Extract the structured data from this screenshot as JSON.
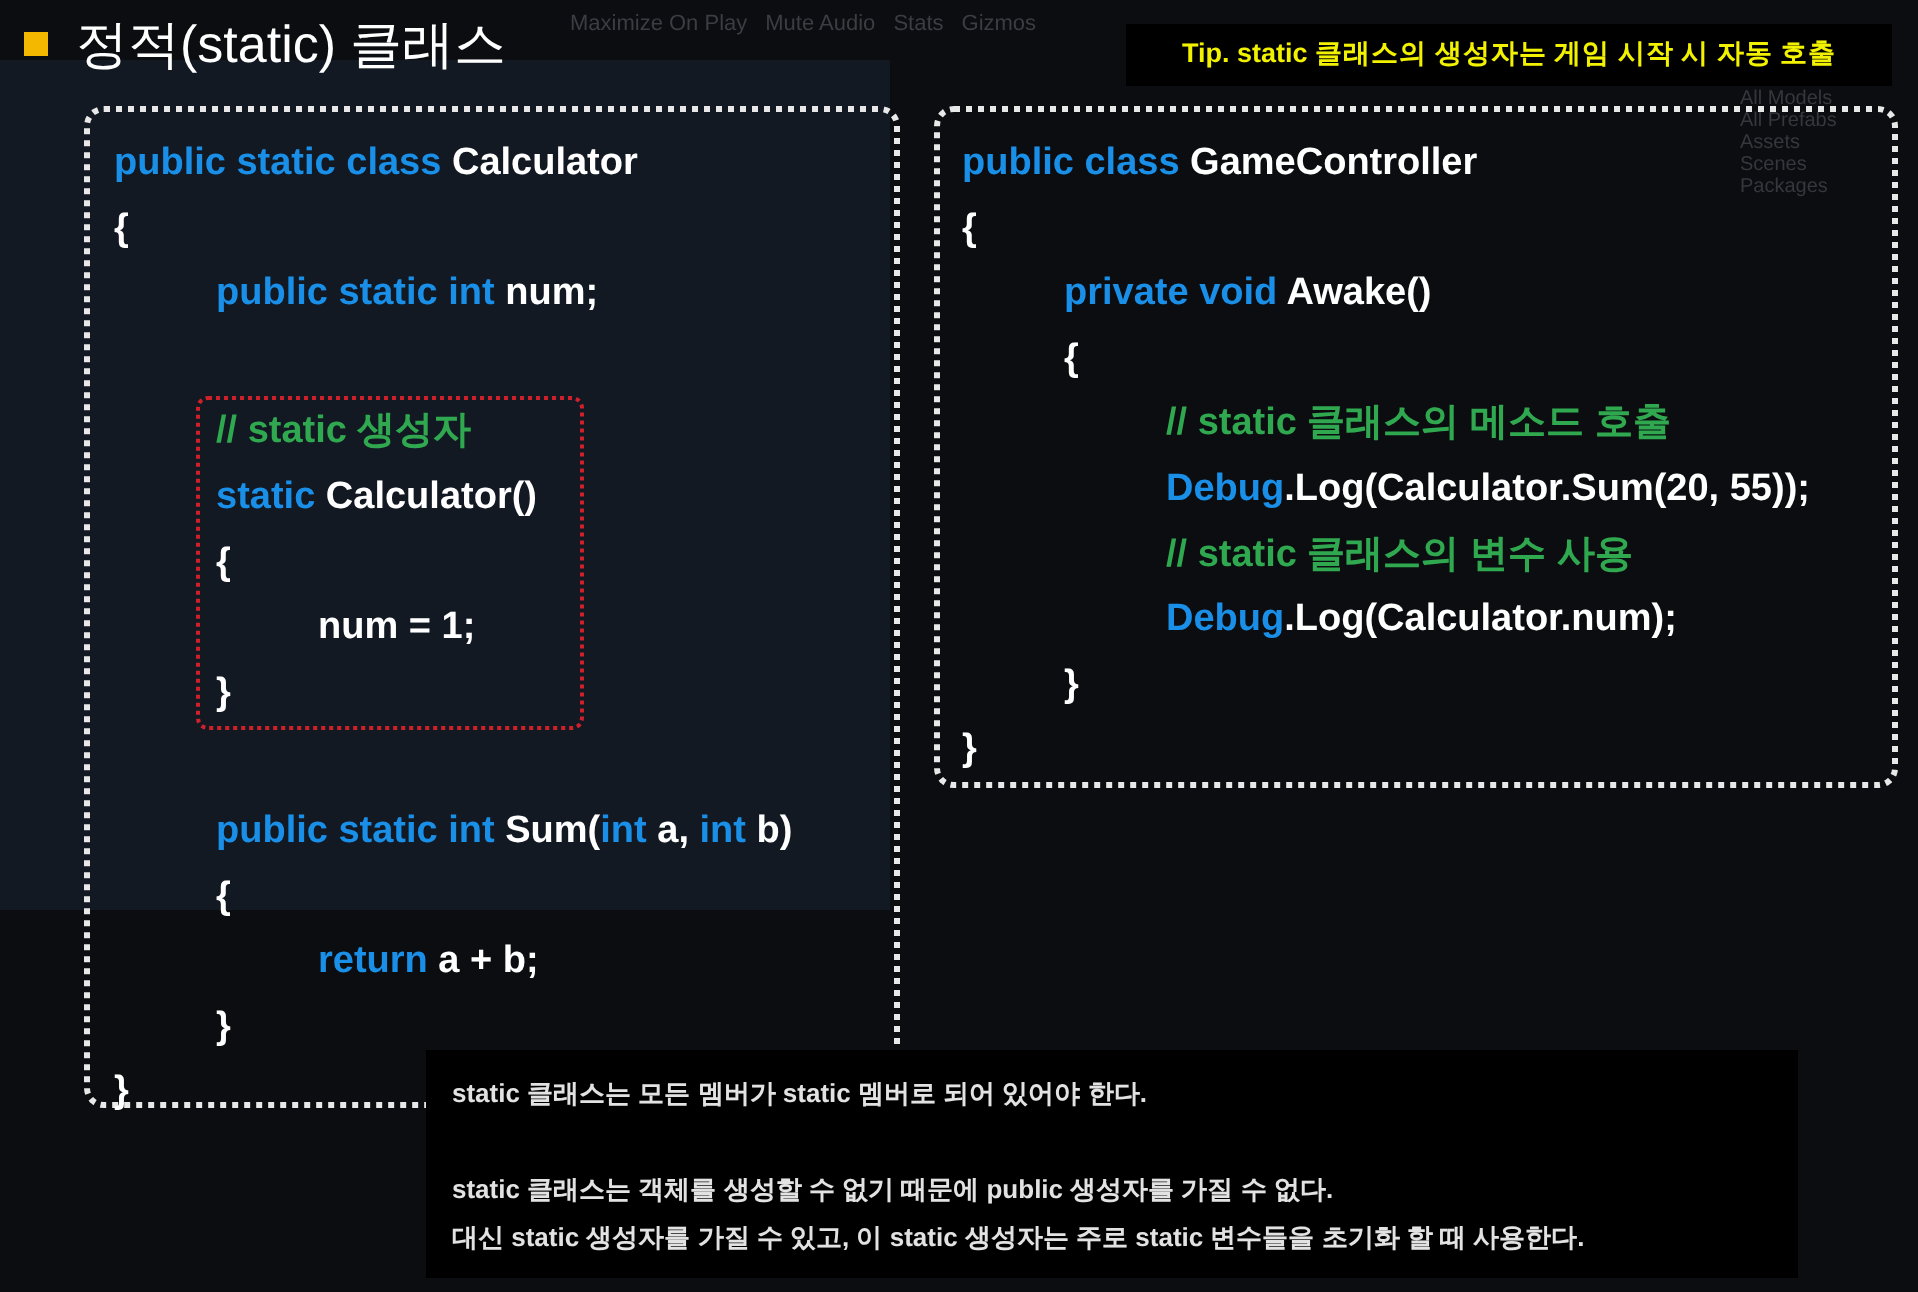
{
  "editor_toolbar": [
    "Maximize On Play",
    "Mute Audio",
    "Stats",
    "Gizmos"
  ],
  "project_tree": [
    "All Models",
    "All Prefabs",
    "Assets",
    "Scenes",
    "Packages"
  ],
  "title": "정적(static) 클래스",
  "tip": "Tip. static 클래스의 생성자는 게임 시작 시 자동 호출",
  "left_code": [
    {
      "kind": "line",
      "tokens": [
        {
          "kind": "keyword",
          "text": "public static class"
        },
        {
          "kind": "plain",
          "text": " Calculator"
        }
      ]
    },
    {
      "kind": "line",
      "tokens": [
        {
          "kind": "plain",
          "text": "{"
        }
      ],
      "children": [
        {
          "kind": "line",
          "tokens": [
            {
              "kind": "keyword",
              "text": "public static int"
            },
            {
              "kind": "plain",
              "text": " num;"
            }
          ]
        },
        {
          "kind": "blank"
        },
        {
          "kind": "block",
          "lines": [
            {
              "kind": "line",
              "tokens": [
                {
                  "kind": "comment",
                  "text": "// static 생성자"
                }
              ]
            },
            {
              "kind": "line",
              "tokens": [
                {
                  "kind": "keyword",
                  "text": "static"
                },
                {
                  "kind": "plain",
                  "text": " Calculator()"
                }
              ]
            },
            {
              "kind": "line",
              "tokens": [
                {
                  "kind": "plain",
                  "text": "{"
                }
              ],
              "children": [
                {
                  "kind": "line",
                  "tokens": [
                    {
                      "kind": "plain",
                      "text": "num = 1;"
                    }
                  ]
                }
              ]
            },
            {
              "kind": "line",
              "tokens": [
                {
                  "kind": "plain",
                  "text": "}"
                }
              ]
            }
          ]
        },
        {
          "kind": "blank"
        },
        {
          "kind": "line",
          "tokens": [
            {
              "kind": "keyword",
              "text": "public static int"
            },
            {
              "kind": "plain",
              "text": " Sum("
            },
            {
              "kind": "keyword",
              "text": "int"
            },
            {
              "kind": "plain",
              "text": " a, "
            },
            {
              "kind": "keyword",
              "text": "int"
            },
            {
              "kind": "plain",
              "text": " b)"
            }
          ]
        },
        {
          "kind": "line",
          "tokens": [
            {
              "kind": "plain",
              "text": "{"
            }
          ],
          "children": [
            {
              "kind": "line",
              "tokens": [
                {
                  "kind": "keyword",
                  "text": "return"
                },
                {
                  "kind": "plain",
                  "text": " a + b;"
                }
              ]
            }
          ]
        },
        {
          "kind": "line",
          "tokens": [
            {
              "kind": "plain",
              "text": "}"
            }
          ]
        }
      ]
    },
    {
      "kind": "line",
      "tokens": [
        {
          "kind": "plain",
          "text": "}"
        }
      ]
    }
  ],
  "right_code": [
    {
      "kind": "line",
      "tokens": [
        {
          "kind": "keyword",
          "text": "public class"
        },
        {
          "kind": "plain",
          "text": " GameController"
        }
      ]
    },
    {
      "kind": "line",
      "tokens": [
        {
          "kind": "plain",
          "text": "{"
        }
      ],
      "children": [
        {
          "kind": "line",
          "tokens": [
            {
              "kind": "keyword",
              "text": "private void"
            },
            {
              "kind": "plain",
              "text": " Awake()"
            }
          ]
        },
        {
          "kind": "line",
          "tokens": [
            {
              "kind": "plain",
              "text": "{"
            }
          ],
          "children": [
            {
              "kind": "line",
              "tokens": [
                {
                  "kind": "comment",
                  "text": "// static 클래스의 메소드 호출"
                }
              ]
            },
            {
              "kind": "line",
              "tokens": [
                {
                  "kind": "keyword",
                  "text": "Debug"
                },
                {
                  "kind": "plain",
                  "text": ".Log(Calculator.Sum(20, 55));"
                }
              ]
            },
            {
              "kind": "line",
              "tokens": [
                {
                  "kind": "comment",
                  "text": "// static 클래스의 변수 사용"
                }
              ]
            },
            {
              "kind": "line",
              "tokens": [
                {
                  "kind": "keyword",
                  "text": "Debug"
                },
                {
                  "kind": "plain",
                  "text": ".Log(Calculator.num);"
                }
              ]
            }
          ]
        },
        {
          "kind": "line",
          "tokens": [
            {
              "kind": "plain",
              "text": "}"
            }
          ]
        }
      ]
    },
    {
      "kind": "line",
      "tokens": [
        {
          "kind": "plain",
          "text": "}"
        }
      ]
    }
  ],
  "notes": [
    "static 클래스는 모든 멤버가 static 멤버로 되어 있어야 한다.",
    "static 클래스는 객체를 생성할 수 없기 때문에 public 생성자를 가질 수 없다.",
    "대신 static 생성자를 가질 수 있고, 이 static 생성자는 주로 static 변수들을 초기화 할 때 사용한다."
  ]
}
